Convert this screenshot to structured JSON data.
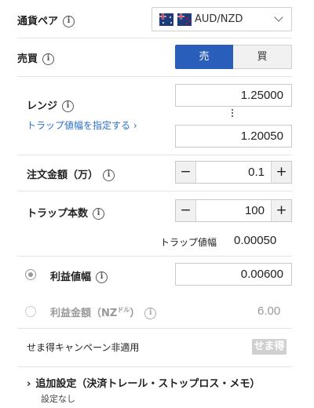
{
  "pair": {
    "label": "通貨ペア",
    "value": "AUD/NZD"
  },
  "side": {
    "label": "売買",
    "sell": "売",
    "buy": "買"
  },
  "range": {
    "label": "レンジ",
    "link": "トラップ値幅を指定する ›",
    "upper": "1.25000",
    "lower": "1.20050"
  },
  "amount": {
    "label": "注文金額（万）",
    "value": "0.1",
    "minus": "−",
    "plus": "+"
  },
  "traps": {
    "label": "トラップ本数",
    "value": "100",
    "minus": "−",
    "plus": "+"
  },
  "trap_width": {
    "label": "トラップ値幅",
    "value": "0.00050"
  },
  "profit_width": {
    "label": "利益値幅",
    "value": "0.00600",
    "selected": true
  },
  "profit_amount": {
    "label": "利益金額（NZ",
    "unit": "ドル",
    "close": "）",
    "value": "6.00",
    "selected": false
  },
  "campaign": {
    "text": "せま得キャンペーン非適用",
    "stamp": "せま得"
  },
  "advanced": {
    "title": "追加設定（決済トレール・ストップロス・メモ）",
    "subtitle": "設定なし",
    "chevron": "›"
  },
  "info_glyph": "i",
  "colors": {
    "accent": "#2a5ebb",
    "link": "#2a6fd1",
    "muted": "#999999"
  }
}
